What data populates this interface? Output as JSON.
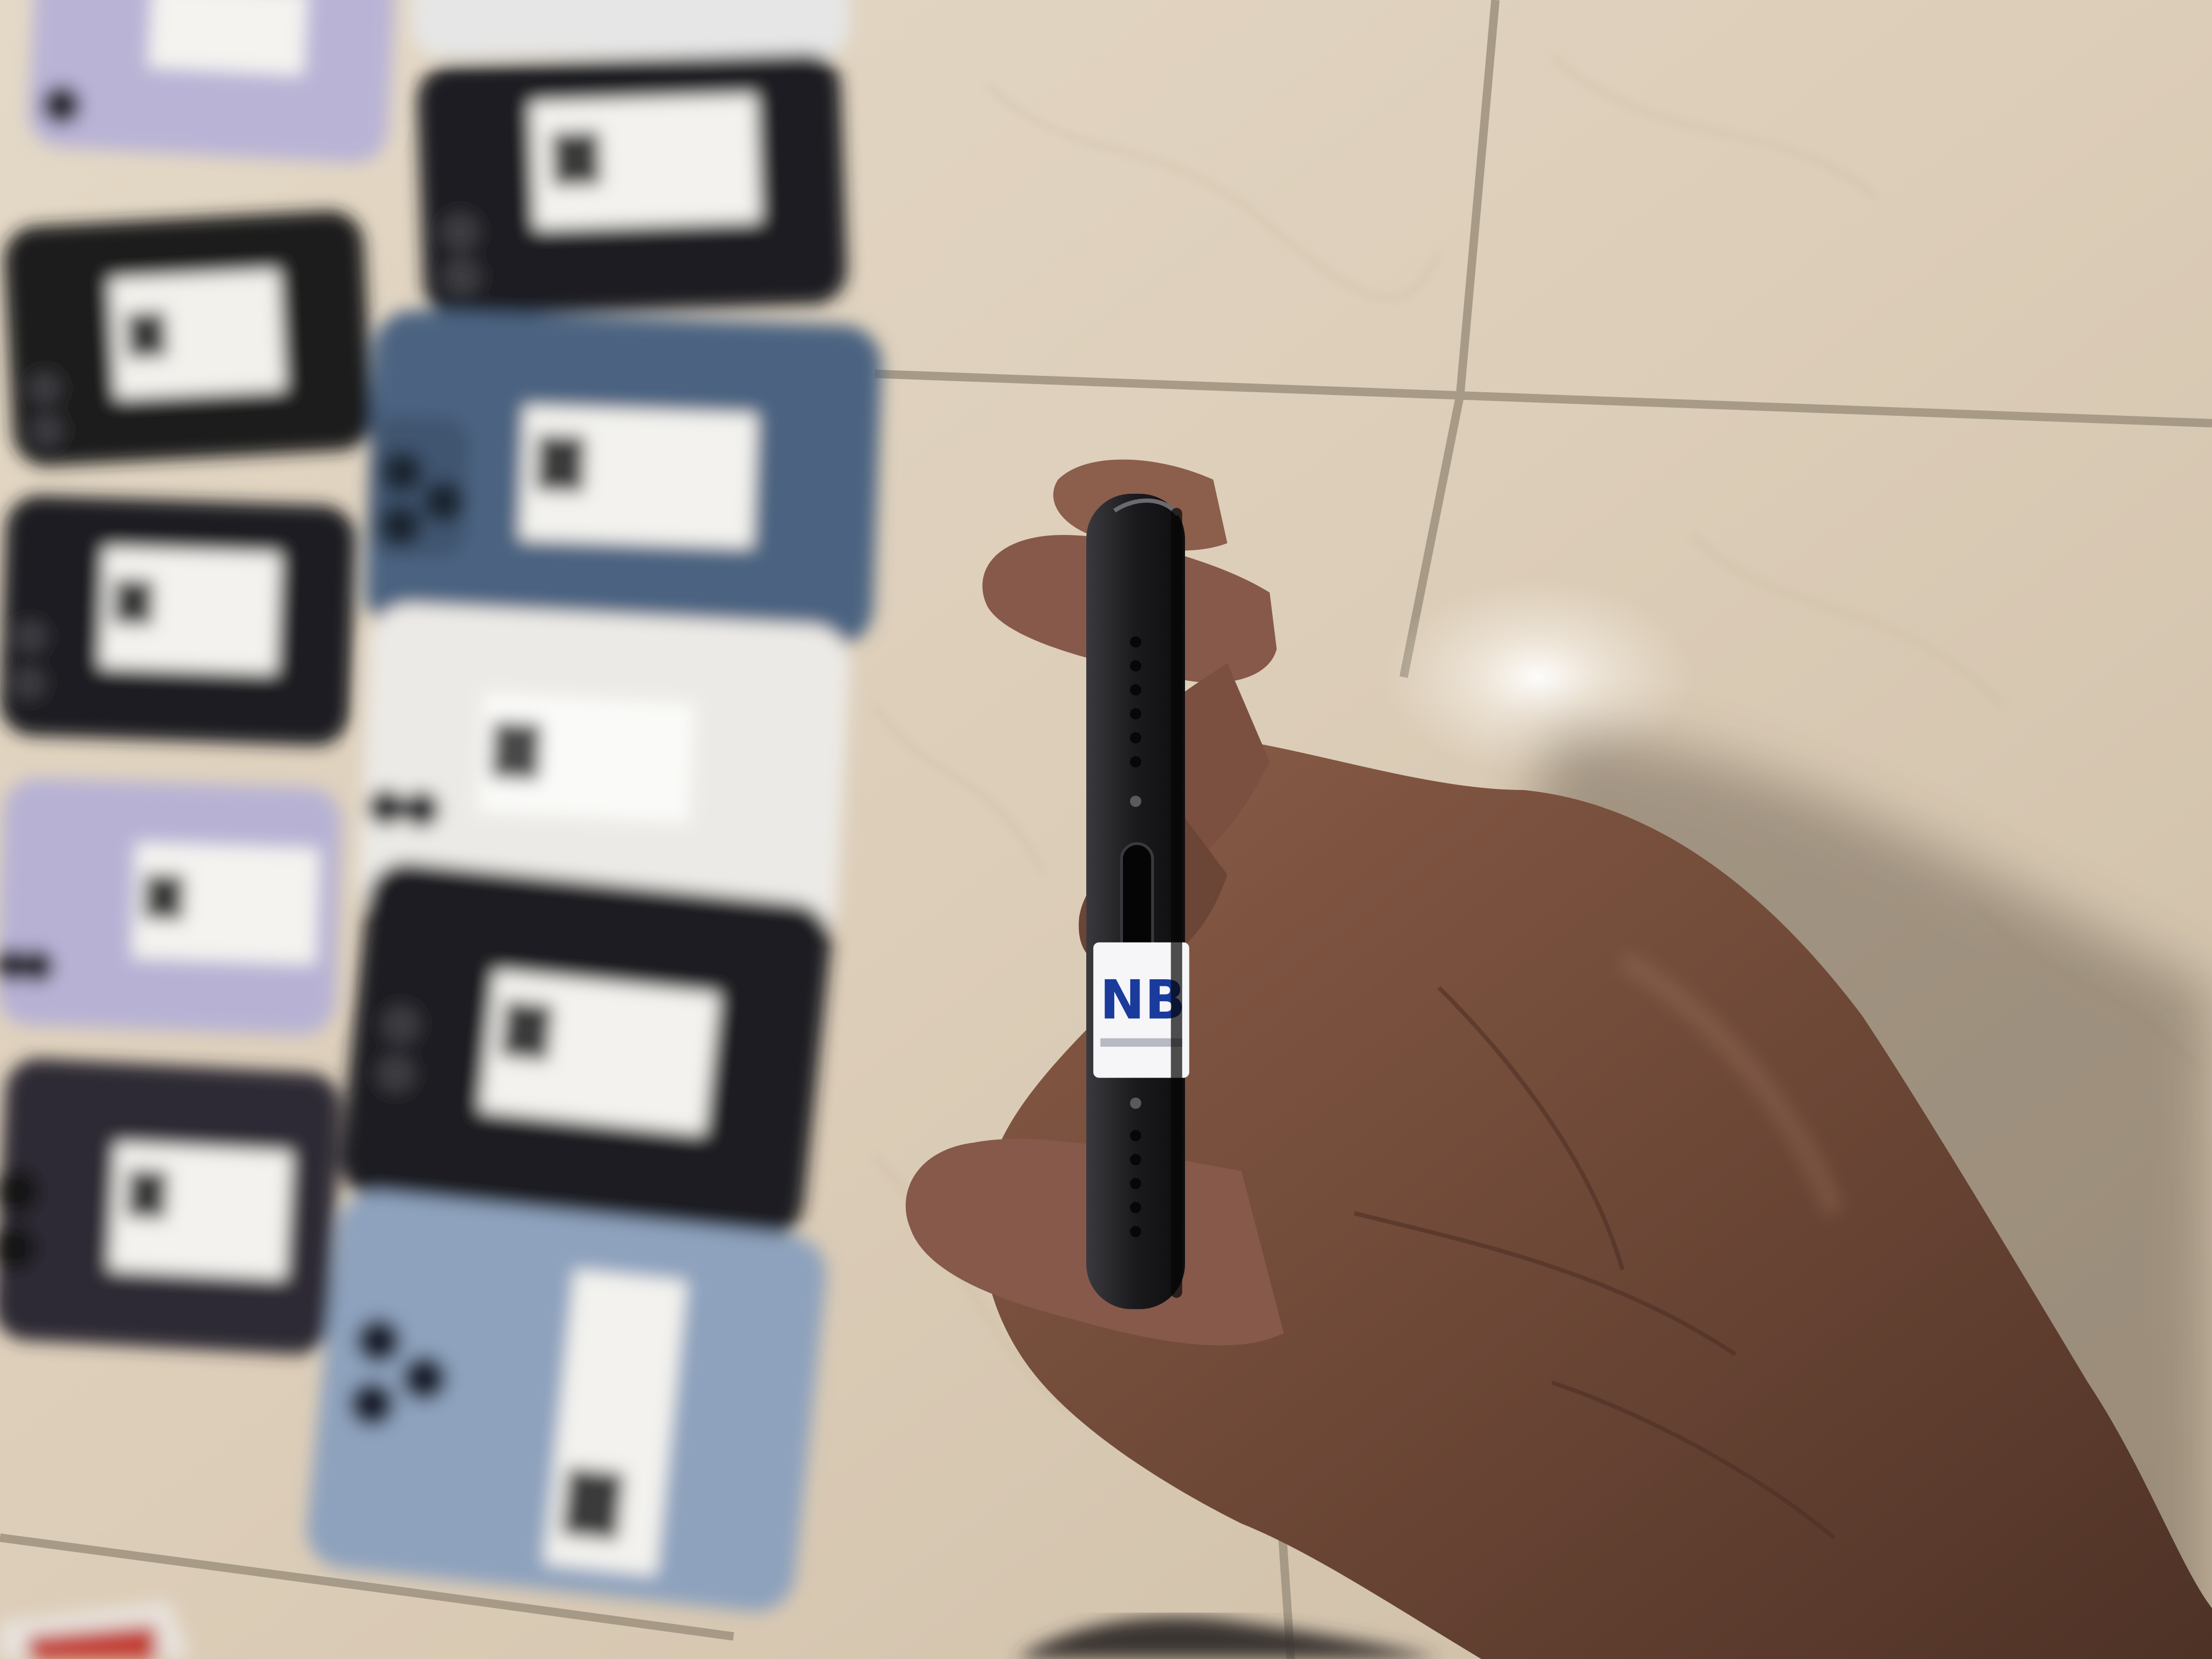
{
  "photo": {
    "label_logo_text": "NB",
    "colors": {
      "tile": "#ddd0bd",
      "grout": "#a89d8b",
      "phone_black": "#1c1c20",
      "phone_purple": "#b9b4d6",
      "phone_blue": "#4d6582",
      "phone_white": "#ecebe8",
      "phone_sierra_blue": "#8ea2bd",
      "phone_deep_purple": "#2e2b36",
      "skin": "#7a5240",
      "logo_blue": "#1a3a9c"
    }
  }
}
